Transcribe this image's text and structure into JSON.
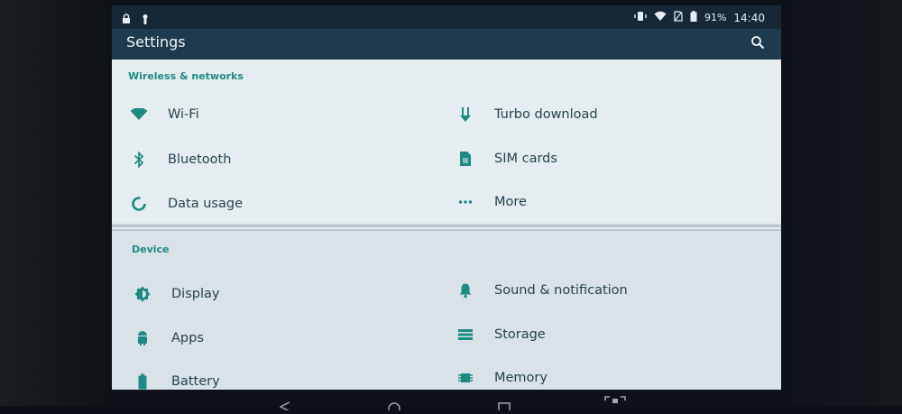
{
  "status_bar": {
    "battery_percent": "91%",
    "time": "14:40"
  },
  "app_bar": {
    "title": "Settings"
  },
  "sections": [
    {
      "header": "Wireless & networks",
      "items": [
        {
          "label": "Wi-Fi",
          "icon": "wifi-icon"
        },
        {
          "label": "Turbo download",
          "icon": "download-arrow-icon"
        },
        {
          "label": "Bluetooth",
          "icon": "bluetooth-icon"
        },
        {
          "label": "SIM cards",
          "icon": "sim-card-icon"
        },
        {
          "label": "Data usage",
          "icon": "data-usage-icon"
        },
        {
          "label": "More",
          "icon": "more-dots-icon"
        }
      ]
    },
    {
      "header": "Device",
      "items": [
        {
          "label": "Display",
          "icon": "display-brightness-icon"
        },
        {
          "label": "Sound & notification",
          "icon": "bell-icon"
        },
        {
          "label": "Apps",
          "icon": "android-icon"
        },
        {
          "label": "Storage",
          "icon": "storage-icon"
        },
        {
          "label": "Battery",
          "icon": "battery-icon"
        },
        {
          "label": "Memory",
          "icon": "memory-chip-icon"
        }
      ]
    }
  ],
  "colors": {
    "accent": "#1e8a84",
    "app_bar": "#1d3a4f",
    "status_bar": "#162838"
  }
}
